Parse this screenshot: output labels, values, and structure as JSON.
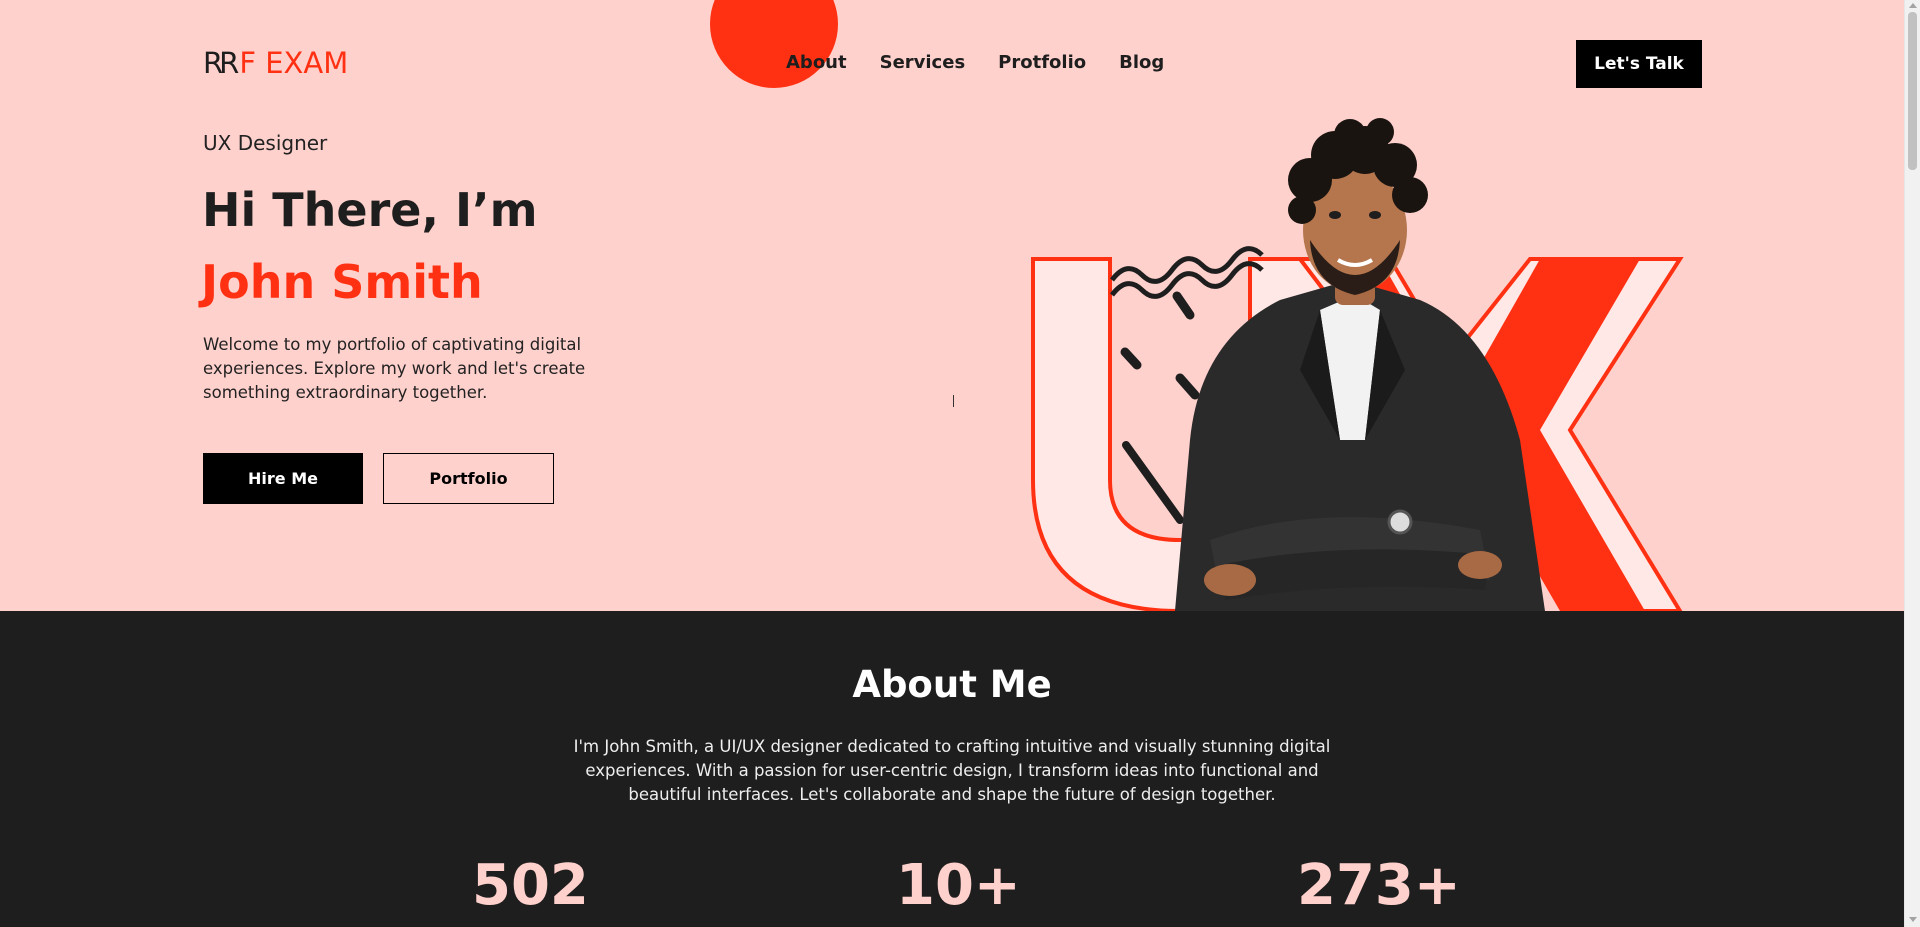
{
  "brand": {
    "logo_prefix": "RR",
    "logo_suffix": "F EXAM"
  },
  "nav": {
    "items": [
      "About",
      "Services",
      "Protfolio",
      "Blog"
    ]
  },
  "header": {
    "cta_label": "Let's Talk"
  },
  "hero": {
    "role": "UX Designer",
    "greeting": "Hi There, I’m",
    "name": "John Smith",
    "intro": "Welcome to my portfolio of captivating digital experiences. Explore my work and let's create something extraordinary together.",
    "hire_label": "Hire Me",
    "portfolio_label": "Portfolio",
    "illustration_letters": "UX"
  },
  "about": {
    "title": "About Me",
    "text": "I'm John Smith, a UI/UX designer dedicated to crafting intuitive and visually stunning digital experiences. With a passion for user-centric design, I transform ideas into functional and beautiful interfaces. Let's collaborate and shape the future of design together.",
    "stats": [
      "502",
      "10+",
      "273+"
    ]
  },
  "colors": {
    "accent": "#ff3112",
    "hero_bg": "#ffd1cd",
    "dark_bg": "#1e1e1e",
    "stat_color": "#ffd1cd"
  },
  "icons": [
    "portrait-photo",
    "ux-letters-graphic"
  ]
}
